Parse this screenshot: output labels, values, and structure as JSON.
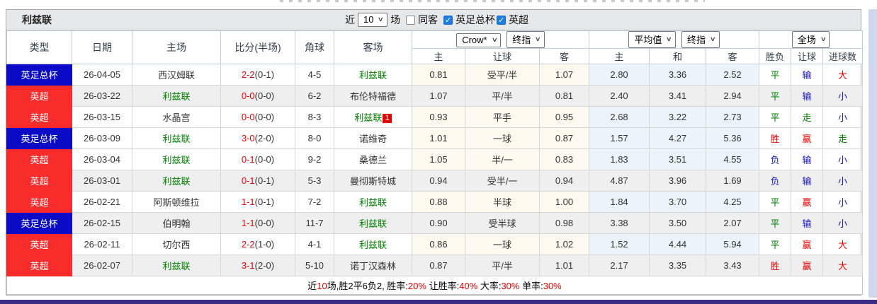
{
  "title": "利兹联",
  "controls": {
    "recent_label": "近",
    "recent_value": "10",
    "matches_label": "场",
    "same_opponent_label": "同客",
    "same_opponent_checked": false,
    "fa_cup_label": "英足总杯",
    "fa_cup_checked": true,
    "epl_label": "英超",
    "epl_checked": true
  },
  "header": {
    "col_type": "类型",
    "col_date": "日期",
    "col_home": "主场",
    "col_score": "比分(半场)",
    "col_corner": "角球",
    "col_away": "客场",
    "asia_selects": [
      "Crow*",
      "终指"
    ],
    "euro_selects": [
      "平均值",
      "终指"
    ],
    "scope_select": "全场",
    "sub": [
      "主",
      "让球",
      "客",
      "主",
      "和",
      "客",
      "胜负",
      "让球",
      "进球数"
    ]
  },
  "rows": [
    {
      "league": "英足总杯",
      "lcolor": "blue",
      "date": "26-04-05",
      "home": "西汉姆联",
      "homeGreen": false,
      "score": "2-2",
      "half": "(0-1)",
      "corner": "4-5",
      "away": "利兹联",
      "awayGreen": true,
      "badge": "",
      "a": [
        "0.81",
        "受平/半",
        "1.07"
      ],
      "e": [
        "2.80",
        "3.36",
        "2.52"
      ],
      "r": [
        [
          "平",
          "g"
        ],
        [
          "输",
          "b"
        ],
        [
          "大",
          "r"
        ]
      ],
      "striped": false
    },
    {
      "league": "英超",
      "lcolor": "red",
      "date": "26-03-22",
      "home": "利兹联",
      "homeGreen": true,
      "score": "0-0",
      "half": "(0-0)",
      "corner": "6-2",
      "away": "布伦特福德",
      "awayGreen": false,
      "badge": "",
      "a": [
        "1.07",
        "平/半",
        "0.81"
      ],
      "e": [
        "2.40",
        "3.41",
        "2.94"
      ],
      "r": [
        [
          "平",
          "g"
        ],
        [
          "输",
          "b"
        ],
        [
          "小",
          "b"
        ]
      ],
      "striped": true
    },
    {
      "league": "英超",
      "lcolor": "red",
      "date": "26-03-15",
      "home": "水晶宫",
      "homeGreen": false,
      "score": "0-0",
      "half": "(0-0)",
      "corner": "8-3",
      "away": "利兹联",
      "awayGreen": true,
      "badge": "1",
      "a": [
        "0.93",
        "平手",
        "0.95"
      ],
      "e": [
        "2.68",
        "3.22",
        "2.73"
      ],
      "r": [
        [
          "平",
          "g"
        ],
        [
          "走",
          "g"
        ],
        [
          "小",
          "b"
        ]
      ],
      "striped": false
    },
    {
      "league": "英足总杯",
      "lcolor": "blue",
      "date": "26-03-09",
      "home": "利兹联",
      "homeGreen": true,
      "score": "3-0",
      "half": "(2-0)",
      "corner": "8-0",
      "away": "诺维奇",
      "awayGreen": false,
      "badge": "",
      "a": [
        "1.01",
        "一球",
        "0.87"
      ],
      "e": [
        "1.57",
        "4.27",
        "5.36"
      ],
      "r": [
        [
          "胜",
          "r"
        ],
        [
          "赢",
          "r"
        ],
        [
          "走",
          "g"
        ]
      ],
      "striped": false
    },
    {
      "league": "英超",
      "lcolor": "red",
      "date": "26-03-04",
      "home": "利兹联",
      "homeGreen": true,
      "score": "0-1",
      "half": "(0-0)",
      "corner": "9-2",
      "away": "桑德兰",
      "awayGreen": false,
      "badge": "",
      "a": [
        "1.05",
        "半/一",
        "0.83"
      ],
      "e": [
        "1.83",
        "3.51",
        "4.55"
      ],
      "r": [
        [
          "负",
          "b"
        ],
        [
          "输",
          "b"
        ],
        [
          "小",
          "b"
        ]
      ],
      "striped": false
    },
    {
      "league": "英超",
      "lcolor": "red",
      "date": "26-03-01",
      "home": "利兹联",
      "homeGreen": true,
      "score": "0-1",
      "half": "(0-1)",
      "corner": "5-3",
      "away": "曼彻斯特城",
      "awayGreen": false,
      "badge": "",
      "a": [
        "0.94",
        "受半/一",
        "0.94"
      ],
      "e": [
        "4.87",
        "3.96",
        "1.69"
      ],
      "r": [
        [
          "负",
          "b"
        ],
        [
          "输",
          "b"
        ],
        [
          "小",
          "b"
        ]
      ],
      "striped": true
    },
    {
      "league": "英超",
      "lcolor": "red",
      "date": "26-02-21",
      "home": "阿斯顿维拉",
      "homeGreen": false,
      "score": "1-1",
      "half": "(0-1)",
      "corner": "7-2",
      "away": "利兹联",
      "awayGreen": true,
      "badge": "",
      "a": [
        "0.88",
        "半球",
        "1.00"
      ],
      "e": [
        "1.84",
        "3.70",
        "4.25"
      ],
      "r": [
        [
          "平",
          "g"
        ],
        [
          "赢",
          "r"
        ],
        [
          "小",
          "b"
        ]
      ],
      "striped": false
    },
    {
      "league": "英足总杯",
      "lcolor": "blue",
      "date": "26-02-15",
      "home": "伯明翰",
      "homeGreen": false,
      "score": "1-1",
      "half": "(0-0)",
      "corner": "11-7",
      "away": "利兹联",
      "awayGreen": true,
      "badge": "",
      "a": [
        "0.90",
        "受半球",
        "0.98"
      ],
      "e": [
        "3.38",
        "3.50",
        "2.07"
      ],
      "r": [
        [
          "平",
          "g"
        ],
        [
          "输",
          "b"
        ],
        [
          "小",
          "b"
        ]
      ],
      "striped": true
    },
    {
      "league": "英超",
      "lcolor": "red",
      "date": "26-02-11",
      "home": "切尔西",
      "homeGreen": false,
      "score": "2-2",
      "half": "(1-0)",
      "corner": "4-1",
      "away": "利兹联",
      "awayGreen": true,
      "badge": "",
      "a": [
        "0.86",
        "一球",
        "1.02"
      ],
      "e": [
        "1.52",
        "4.44",
        "5.94"
      ],
      "r": [
        [
          "平",
          "g"
        ],
        [
          "赢",
          "r"
        ],
        [
          "大",
          "r"
        ]
      ],
      "striped": false
    },
    {
      "league": "英超",
      "lcolor": "red",
      "date": "26-02-07",
      "home": "利兹联",
      "homeGreen": true,
      "score": "3-1",
      "half": "(2-0)",
      "corner": "5-10",
      "away": "诺丁汉森林",
      "awayGreen": false,
      "badge": "",
      "a": [
        "0.87",
        "平/半",
        "1.01"
      ],
      "e": [
        "2.17",
        "3.35",
        "3.43"
      ],
      "r": [
        [
          "胜",
          "r"
        ],
        [
          "赢",
          "r"
        ],
        [
          "大",
          "r"
        ]
      ],
      "striped": true
    }
  ],
  "footer": {
    "parts": [
      {
        "text": "近",
        "red": false
      },
      {
        "text": "10",
        "red": true
      },
      {
        "text": "场,胜2平6负2, 胜率:",
        "red": false
      },
      {
        "text": "20%",
        "red": true
      },
      {
        "text": " 让胜率:",
        "red": false
      },
      {
        "text": "40%",
        "red": true
      },
      {
        "text": " 大率:",
        "red": false
      },
      {
        "text": "30%",
        "red": true
      },
      {
        "text": " 单率:",
        "red": false
      },
      {
        "text": "30%",
        "red": true
      }
    ]
  },
  "colors": {
    "cup_badge": "#0b0bc7",
    "epl_badge": "#fa2b2b",
    "focus_team_green": "#008000",
    "score_red": "#e60000",
    "loss_blue": "#1515cc",
    "asia_odds_bg": "#fdf9ee",
    "euro_odds_bg": "#eaf4fa",
    "stripe_bg": "#efefef",
    "title_bar_bg": "#e7e8ea",
    "bottom_bar": "#3b2d87",
    "right_strip": "#cfd8ee"
  }
}
